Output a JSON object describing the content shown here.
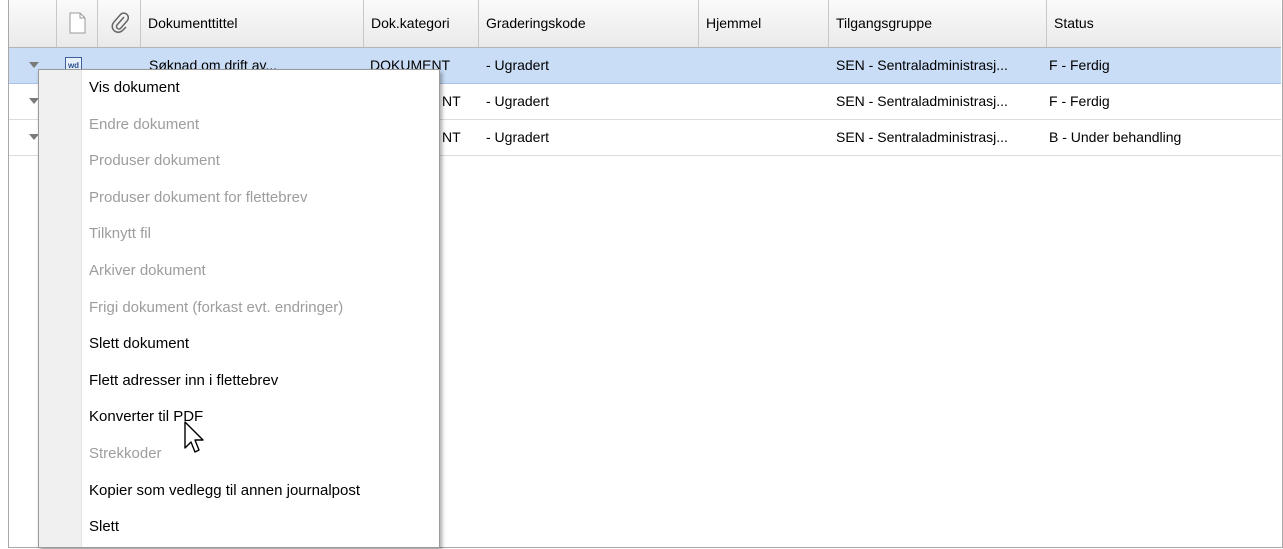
{
  "table": {
    "columns": [
      "Dokumenttittel",
      "Dok.kategori",
      "Graderingskode",
      "Hjemmel",
      "Tilgangsgruppe",
      "Status"
    ],
    "rows": [
      {
        "title": "Søknad om drift av...",
        "category": "DOKUMENT",
        "grading": "- Ugradert",
        "hjemmel": "",
        "access": "SEN - Sentraladministrasj...",
        "status": "F - Ferdig",
        "icon": "wd",
        "selected": true
      },
      {
        "title": "",
        "category": "NT",
        "grading": "- Ugradert",
        "hjemmel": "",
        "access": "SEN - Sentraladministrasj...",
        "status": "F - Ferdig"
      },
      {
        "title": "",
        "category": "NT",
        "grading": "- Ugradert",
        "hjemmel": "",
        "access": "SEN - Sentraladministrasj...",
        "status": "B - Under behandling"
      }
    ]
  },
  "context_menu": {
    "items": [
      {
        "label": "Vis dokument",
        "enabled": true
      },
      {
        "label": "Endre dokument",
        "enabled": false
      },
      {
        "label": "Produser dokument",
        "enabled": false
      },
      {
        "label": "Produser dokument for flettebrev",
        "enabled": false
      },
      {
        "label": "Tilknytt fil",
        "enabled": false
      },
      {
        "label": "Arkiver dokument",
        "enabled": false
      },
      {
        "label": "Frigi dokument (forkast evt. endringer)",
        "enabled": false
      },
      {
        "label": "Slett dokument",
        "enabled": true
      },
      {
        "label": "Flett adresser inn i flettebrev",
        "enabled": true
      },
      {
        "label": "Konverter til PDF",
        "enabled": true
      },
      {
        "label": "Strekkoder",
        "enabled": false
      },
      {
        "label": "Kopier som vedlegg til annen journalpost",
        "enabled": true
      },
      {
        "label": "Slett",
        "enabled": true
      }
    ]
  },
  "colors": {
    "selected_row": "#c9ddf6",
    "disabled_text": "#9d9d9d"
  }
}
